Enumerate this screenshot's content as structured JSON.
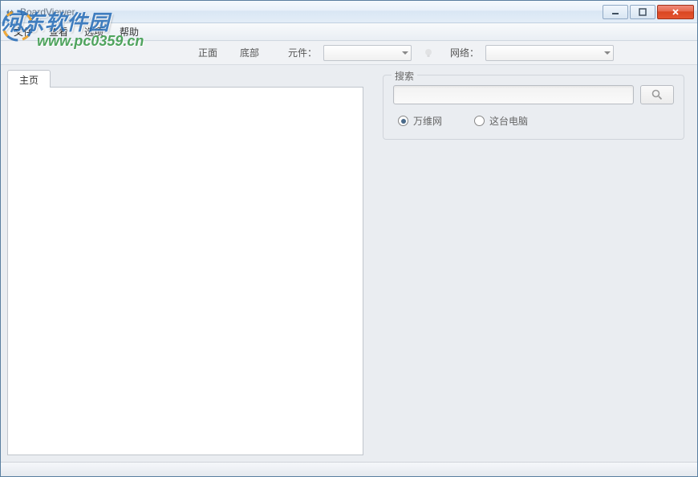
{
  "window": {
    "title": "BoardViewer"
  },
  "menu": {
    "file": "文件",
    "view": "查看",
    "options": "选项",
    "help": "帮助"
  },
  "toolbar": {
    "front": "正面",
    "bottom": "底部",
    "component_label": "元件：",
    "network_label": "网络："
  },
  "tabs": {
    "home": "主页"
  },
  "search": {
    "group_label": "搜索",
    "placeholder": "",
    "radio_www": "万维网",
    "radio_local": "这台电脑"
  },
  "watermark": {
    "line1": "河东软件园",
    "line2": "www.pc0359.cn"
  }
}
